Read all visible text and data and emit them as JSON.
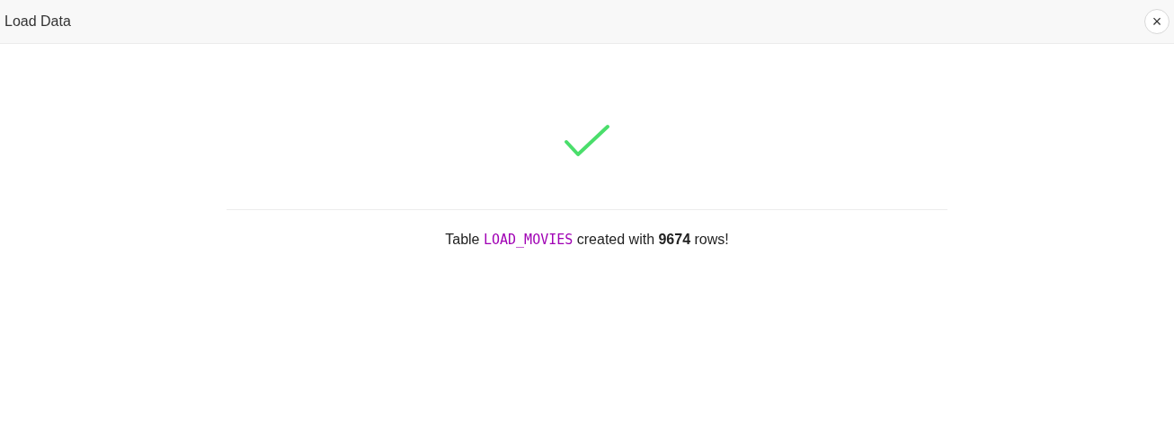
{
  "window": {
    "title": "Load Data",
    "close_button": "×"
  },
  "result": {
    "succeeded": true,
    "message": [
      {
        "kind": "text",
        "text": "Table "
      },
      {
        "kind": "code",
        "text": "LOAD_MOVIES"
      },
      {
        "kind": "text",
        "text": " created with "
      },
      {
        "kind": "bold",
        "text": "9674"
      },
      {
        "kind": "text",
        "text": " rows!"
      }
    ]
  }
}
